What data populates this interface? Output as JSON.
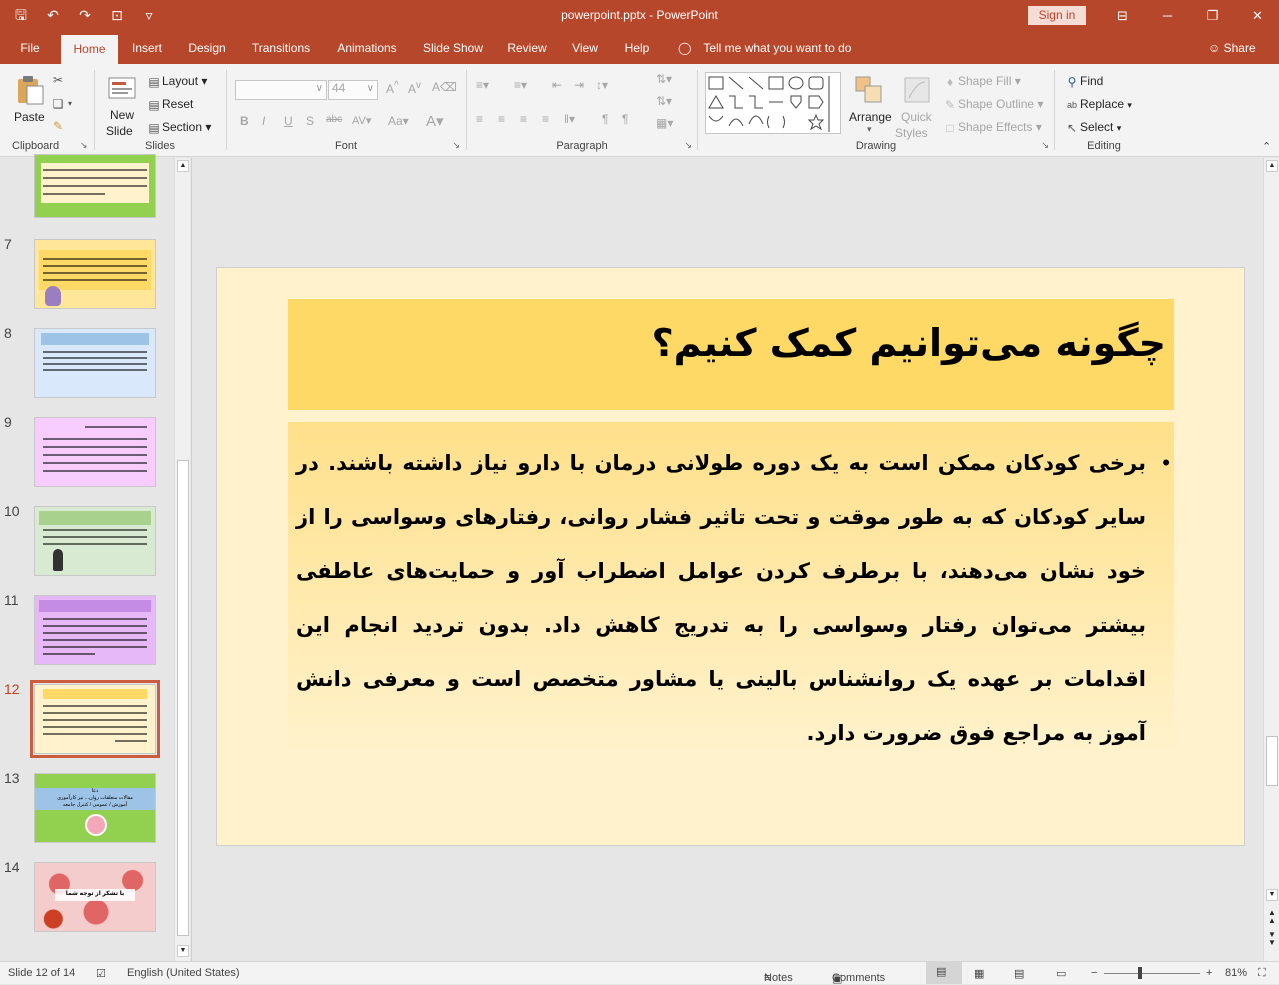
{
  "window": {
    "title": "powerpoint.pptx  -  PowerPoint",
    "signin_label": "Sign in",
    "minimize": "─",
    "restore": "❐",
    "close": "✕",
    "ribbon_display": "⊟"
  },
  "qat": {
    "save": "🖫",
    "undo": "↶",
    "redo": "↷",
    "present": "⊡",
    "customize": "▿"
  },
  "tabs": [
    "File",
    "Home",
    "Insert",
    "Design",
    "Transitions",
    "Animations",
    "Slide Show",
    "Review",
    "View",
    "Help"
  ],
  "active_tab": "Home",
  "tell_me": "Tell me what you want to do",
  "share": "Share",
  "ribbon": {
    "clipboard": {
      "label": "Clipboard",
      "paste": "Paste"
    },
    "slides": {
      "label": "Slides",
      "new_slide_1": "New",
      "new_slide_2": "Slide",
      "layout": "Layout",
      "reset": "Reset",
      "section": "Section"
    },
    "font": {
      "label": "Font",
      "font_name": "",
      "font_size": "44"
    },
    "paragraph": {
      "label": "Paragraph"
    },
    "drawing": {
      "label": "Drawing",
      "arrange": "Arrange",
      "quick_styles_1": "Quick",
      "quick_styles_2": "Styles",
      "shape_fill": "Shape Fill",
      "shape_outline": "Shape Outline",
      "shape_effects": "Shape Effects"
    },
    "editing": {
      "label": "Editing",
      "find": "Find",
      "replace": "Replace",
      "select": "Select"
    }
  },
  "thumbnails": [
    {
      "num": "7",
      "bg": "#ffe699",
      "band": "#ffd966"
    },
    {
      "num": "8",
      "bg": "#dae8fc",
      "band": "#9dc3e6"
    },
    {
      "num": "9",
      "bg": "#f7ccff",
      "band": "#e9a6f7"
    },
    {
      "num": "10",
      "bg": "#d9ead3",
      "band": "#a9d18e"
    },
    {
      "num": "11",
      "bg": "#e6b8f7",
      "band": "#c58ce6"
    },
    {
      "num": "12",
      "bg": "#fff2cc",
      "band": "#ffd966"
    },
    {
      "num": "13",
      "bg": "#92d050",
      "band": "#9dc3e6"
    },
    {
      "num": "14",
      "bg": "#f4cccc",
      "band": "#ffffff"
    }
  ],
  "thumb_texts": {
    "t13_1": "دعا",
    "t13_2": "مقالات متعلقات روان... نیز کارآموزی",
    "t13_3": "آموزش / عمومی / کنترل جامعه",
    "t14": "با تشکر از توجه شما"
  },
  "slide": {
    "title": "چگونه می‌توانیم کمک کنیم؟",
    "bullet_mark": "•",
    "body": "برخی کودکان ممکن است به یک دوره طولانی درمان با دارو نیاز داشته باشند. در سایر کودکان که به طور موقت و تحت تاثیر فشار روانی، رفتارهای وسواسی را از خود نشان می‌دهند، با برطرف کردن عوامل اضطراب آور و حمایت‌های عاطفی بیشتر می‌توان رفتار وسواسی را به تدریج کاهش داد. بدون تردید انجام این اقدامات بر عهده یک روانشناس بالینی یا مشاور متخصص است و معرفی دانش آموز به مراجع فوق ضرورت دارد."
  },
  "status": {
    "slide_info": "Slide 12 of 14",
    "language": "English (United States)",
    "notes": "Notes",
    "comments": "Comments",
    "zoom": "81%",
    "zoom_minus": "−",
    "zoom_plus": "+"
  },
  "colors": {
    "accent": "#b7472a",
    "title_band": "#ffd966",
    "slide_bg": "#fff2cc"
  }
}
